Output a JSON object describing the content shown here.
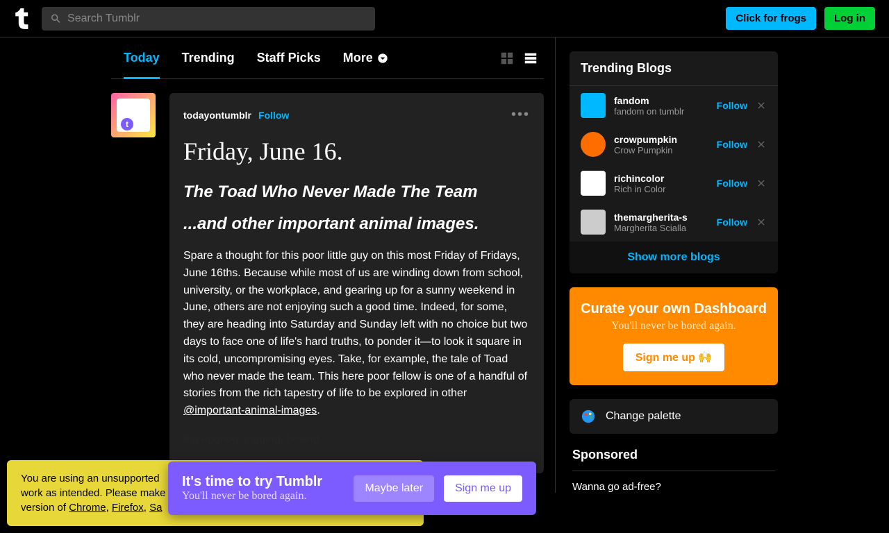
{
  "header": {
    "search_placeholder": "Search Tumblr",
    "btn_frogs": "Click for frogs",
    "btn_login": "Log in"
  },
  "tabs": {
    "today": "Today",
    "trending": "Trending",
    "staff": "Staff Picks",
    "more": "More"
  },
  "post": {
    "author": "todayontumblr",
    "follow": "Follow",
    "title": "Friday, June 16.",
    "subtitle1": "The Toad Who Never Made The Team",
    "subtitle2": "...and other important animal images.",
    "body1": "Spare a thought for this poor little guy on this most Friday of Fridays, June 16ths. Because while most of us are winding down from school, university, or the workplace, and gearing up for a sunny weekend in June, others are not enjoying such a good time. Indeed, for some, they are heading into Saturday and Sunday left with no choice but two days to face one of life's hard truths, to ponder it—to look it square in its cold, uncompromising eyes. Take, for example, the tale of Toad who never made the team. This here poor fellow is one of a handful of stories from the rich tapestry of life to be explored in other ",
    "body1_link": "@important-animal-images",
    "body2_fragment": "ing eggnog, jogging, boxing"
  },
  "sidebar": {
    "trending_title": "Trending Blogs",
    "blogs": [
      {
        "name": "fandom",
        "sub": "fandom on tumblr",
        "color": "#00b8ff"
      },
      {
        "name": "crowpumpkin",
        "sub": "Crow Pumpkin",
        "color": "#ff6d00"
      },
      {
        "name": "richincolor",
        "sub": "Rich in Color",
        "color": "#ffffff"
      },
      {
        "name": "themargherita-s",
        "sub": "Margherita Scialla",
        "color": "#cccccc"
      }
    ],
    "follow_label": "Follow",
    "show_more": "Show more blogs",
    "curate_title": "Curate your own Dashboard",
    "curate_sub": "You'll never be bored again.",
    "curate_btn": "Sign me up 🙌",
    "palette": "Change palette",
    "sponsored": "Sponsored",
    "adfree": "Wanna go ad-free?"
  },
  "banner_yellow": {
    "text_pre": "You are using an unsupported",
    "text_mid": "work as intended. Please make",
    "text_post": "version of ",
    "browsers": [
      "Chrome",
      "Firefox",
      "Sa"
    ]
  },
  "banner_purple": {
    "title": "It's time to try Tumblr",
    "sub": "You'll never be bored again.",
    "btn1": "Maybe later",
    "btn2": "Sign me up"
  }
}
